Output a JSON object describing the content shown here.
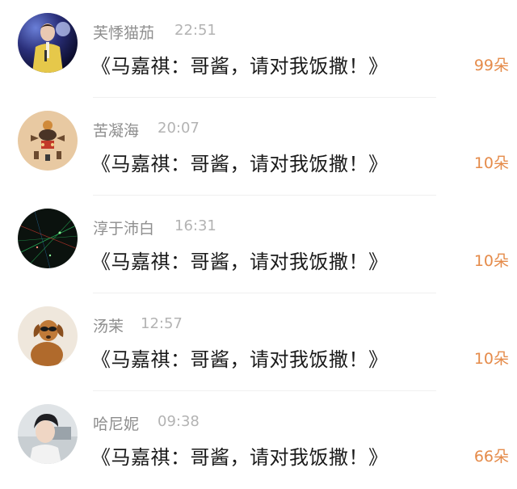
{
  "items": [
    {
      "name": "芙悸猫茄",
      "time": "22:51",
      "message": "《马嘉祺：哥酱，请对我饭撒！》",
      "count": "99朵"
    },
    {
      "name": "苦凝海",
      "time": "20:07",
      "message": "《马嘉祺：哥酱，请对我饭撒！》",
      "count": "10朵"
    },
    {
      "name": "淳于沛白",
      "time": "16:31",
      "message": "《马嘉祺：哥酱，请对我饭撒！》",
      "count": "10朵"
    },
    {
      "name": "汤茉",
      "time": "12:57",
      "message": "《马嘉祺：哥酱，请对我饭撒！》",
      "count": "10朵"
    },
    {
      "name": "哈尼妮",
      "time": "09:38",
      "message": "《马嘉祺：哥酱，请对我饭撒！》",
      "count": "66朵"
    }
  ]
}
